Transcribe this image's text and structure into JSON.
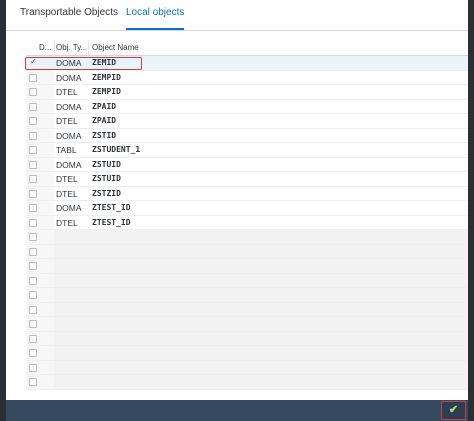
{
  "tabs": [
    {
      "label": "Transportable Objects",
      "active": false
    },
    {
      "label": "Local objects",
      "active": true
    }
  ],
  "table": {
    "columns": [
      "D...",
      "Obj. Ty...",
      "Object Name"
    ],
    "rows": [
      {
        "checked": true,
        "type": "DOMA",
        "name": "ZEMID"
      },
      {
        "checked": false,
        "type": "DOMA",
        "name": "ZEMPID"
      },
      {
        "checked": false,
        "type": "DTEL",
        "name": "ZEMPID"
      },
      {
        "checked": false,
        "type": "DOMA",
        "name": "ZPAID"
      },
      {
        "checked": false,
        "type": "DTEL",
        "name": "ZPAID"
      },
      {
        "checked": false,
        "type": "DOMA",
        "name": "ZSTID"
      },
      {
        "checked": false,
        "type": "TABL",
        "name": "ZSTUDENT_1"
      },
      {
        "checked": false,
        "type": "DOMA",
        "name": "ZSTUID"
      },
      {
        "checked": false,
        "type": "DTEL",
        "name": "ZSTUID"
      },
      {
        "checked": false,
        "type": "DTEL",
        "name": "ZSTZID"
      },
      {
        "checked": false,
        "type": "DOMA",
        "name": "ZTEST_ID"
      },
      {
        "checked": false,
        "type": "DTEL",
        "name": "ZTEST_ID"
      }
    ],
    "empty_rows": 11
  },
  "footer": {
    "confirm_icon": "checkmark-icon",
    "confirm_glyph": "✔"
  },
  "colors": {
    "accent": "#0a6ed1",
    "highlight_border": "#d23b3b",
    "footer_bg": "#354a5f",
    "confirm_icon": "#a8e06a"
  }
}
